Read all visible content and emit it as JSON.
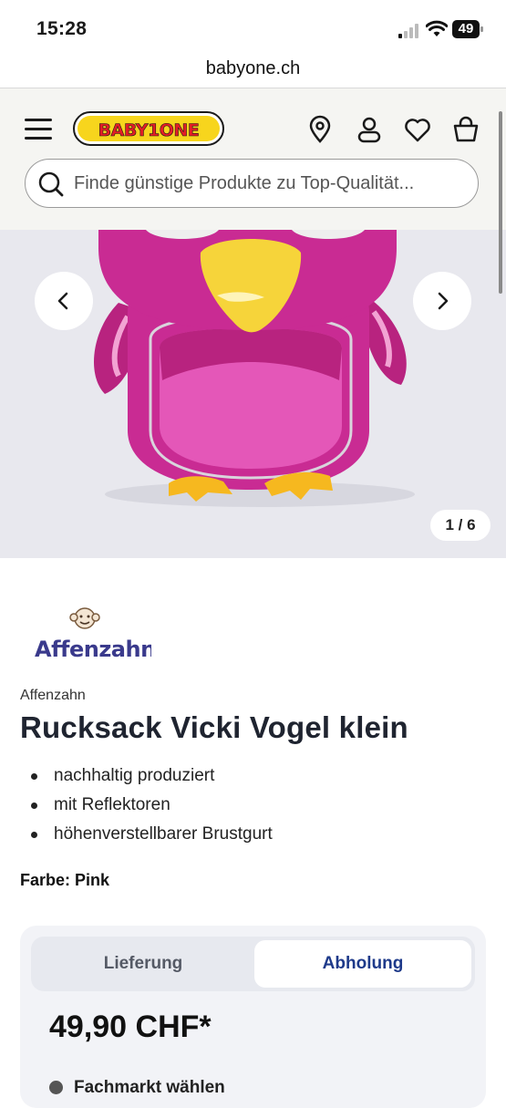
{
  "status_bar": {
    "time": "15:28",
    "battery": "49"
  },
  "browser": {
    "url": "babyone.ch"
  },
  "header": {
    "logo_text": "BABY1ONE",
    "search_placeholder": "Finde günstige Produkte zu Top-Qualität..."
  },
  "gallery": {
    "counter": "1 / 6"
  },
  "product": {
    "brand_logo_text": "Affenzahn",
    "brand": "Affenzahn",
    "title": "Rucksack Vicki Vogel klein",
    "features": [
      "nachhaltig produziert",
      "mit Reflektoren",
      "höhenverstellbarer Brustgurt"
    ],
    "color_label": "Farbe: Pink"
  },
  "purchase": {
    "tabs": [
      {
        "label": "Lieferung",
        "active": false
      },
      {
        "label": "Abholung",
        "active": true
      }
    ],
    "price": "49,90 CHF*",
    "store_select": "Fachmarkt wählen"
  },
  "colors": {
    "header_bg": "#f5f5f2",
    "active_tab_text": "#1e3a8a",
    "product_pink": "#d63fa6",
    "beak_yellow": "#f6d43a"
  }
}
